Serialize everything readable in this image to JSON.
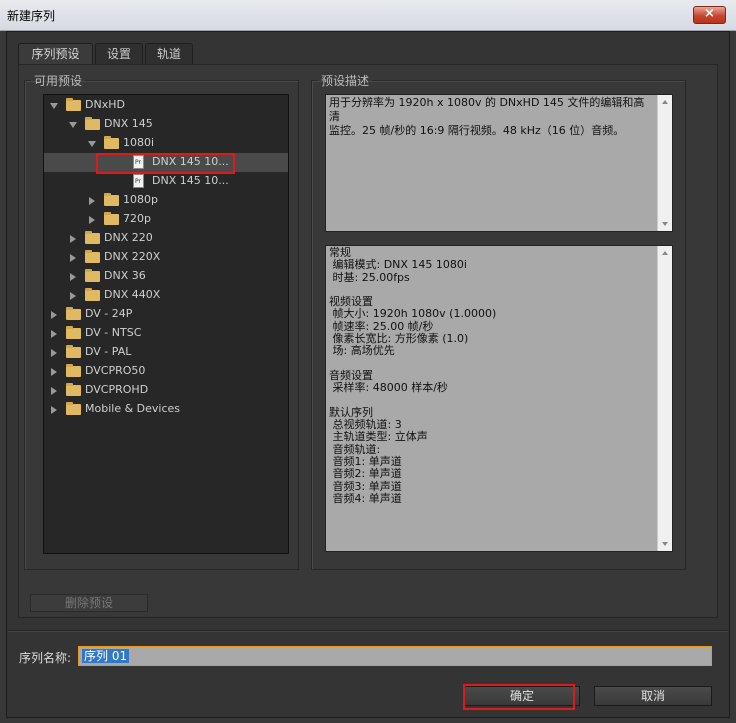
{
  "window": {
    "title": "新建序列",
    "close_label": "×"
  },
  "tabs": [
    {
      "label": "序列预设",
      "active": true
    },
    {
      "label": "设置",
      "active": false
    },
    {
      "label": "轨道",
      "active": false
    }
  ],
  "presets": {
    "legend": "可用预设",
    "tree": [
      {
        "label": "DNxHD",
        "type": "folder",
        "expanded": true
      },
      {
        "label": "DNX 145",
        "type": "folder",
        "expanded": true
      },
      {
        "label": "1080i",
        "type": "folder",
        "expanded": true
      },
      {
        "label": "DNX 145 10...",
        "type": "file",
        "selected": true
      },
      {
        "label": "DNX 145 10...",
        "type": "file"
      },
      {
        "label": "1080p",
        "type": "folder",
        "expanded": false
      },
      {
        "label": "720p",
        "type": "folder",
        "expanded": false
      },
      {
        "label": "DNX 220",
        "type": "folder",
        "expanded": false
      },
      {
        "label": "DNX 220X",
        "type": "folder",
        "expanded": false
      },
      {
        "label": "DNX 36",
        "type": "folder",
        "expanded": false
      },
      {
        "label": "DNX 440X",
        "type": "folder",
        "expanded": false
      },
      {
        "label": "DV - 24P",
        "type": "folder",
        "expanded": false
      },
      {
        "label": "DV - NTSC",
        "type": "folder",
        "expanded": false
      },
      {
        "label": "DV - PAL",
        "type": "folder",
        "expanded": false
      },
      {
        "label": "DVCPRO50",
        "type": "folder",
        "expanded": false
      },
      {
        "label": "DVCPROHD",
        "type": "folder",
        "expanded": false
      },
      {
        "label": "Mobile & Devices",
        "type": "folder",
        "expanded": false
      }
    ],
    "delete_label": "删除预设"
  },
  "description": {
    "legend": "预设描述",
    "summary": "用于分辨率为 1920h x 1080v 的 DNxHD 145 文件的编辑和高清\n监控。25 帧/秒的 16:9 隔行视频。48 kHz（16 位）音频。",
    "details": "常规\n 编辑模式: DNX 145 1080i\n 时基: 25.00fps\n\n视频设置\n 帧大小: 1920h 1080v (1.0000)\n 帧速率: 25.00 帧/秒\n 像素长宽比: 方形像素 (1.0)\n 场: 高场优先\n\n音频设置\n 采样率: 48000 样本/秒\n\n默认序列\n 总视频轨道: 3\n 主轨道类型: 立体声\n 音频轨道:\n 音频1: 单声道\n 音频2: 单声道\n 音频3: 单声道\n 音频4: 单声道"
  },
  "sequence": {
    "label": "序列名称:",
    "value": "序列 01"
  },
  "buttons": {
    "ok": "确定",
    "cancel": "取消"
  },
  "colors": {
    "highlight": "#e01a1a",
    "field_focus": "#e69a1e",
    "selection": "#3278c8"
  }
}
